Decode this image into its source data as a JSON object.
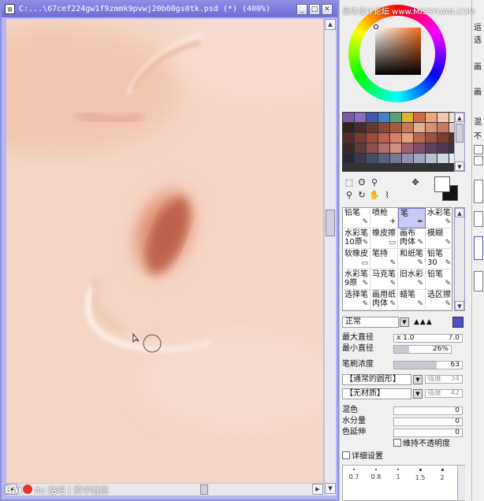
{
  "window": {
    "title": "C:...\\67cef224gw1f9zmmk9pvwj20b60gs0tk.psd (*) (400%)"
  },
  "watermark": {
    "logo": "Bai",
    "paw": "du",
    "text": "贴吧 | 腾宇磨画"
  },
  "branding": {
    "site_text": "思缘设计论坛 www.MISSYUAN.COM"
  },
  "swatch_colors": [
    "#7b58a8",
    "#8b6ac0",
    "#3f5ab0",
    "#4780c8",
    "#5aa078",
    "#e0b030",
    "#d06a48",
    "#e8a878",
    "#f0c8b0",
    "#f4e0d0",
    "#302020",
    "#4a2a2a",
    "#6a3a30",
    "#8a4838",
    "#a85a40",
    "#c87858",
    "#e0b090",
    "#d89070",
    "#c87a60",
    "#e8c8b8",
    "#5a2a28",
    "#7a3a30",
    "#a04a38",
    "#c06048",
    "#d8806a",
    "#e8a080",
    "#b86850",
    "#985040",
    "#784030",
    "#583020",
    "#402828",
    "#603838",
    "#905050",
    "#b07068",
    "#d09080",
    "#a06070",
    "#805068",
    "#604060",
    "#503858",
    "#403048",
    "#282838",
    "#383850",
    "#485068",
    "#586080",
    "#787898",
    "#9090b0",
    "#a0a8c0",
    "#b8c0d0",
    "#d0d8e0",
    "#e8eef4"
  ],
  "tools": {
    "icons": [
      "select-rect-icon",
      "lasso-icon",
      "magic-wand-icon",
      "move-icon",
      "zoom-icon",
      "rotate-icon",
      "hand-icon",
      "eyedropper-icon"
    ]
  },
  "brushes": [
    {
      "label": "铅笔",
      "icon": "✎"
    },
    {
      "label": "喷枪",
      "icon": "✈"
    },
    {
      "label": "笔",
      "icon": "✒"
    },
    {
      "label": "水彩笔",
      "icon": "✎"
    },
    {
      "label": "水彩笔\n10原",
      "icon": "✎"
    },
    {
      "label": "橡皮擦",
      "icon": "▭"
    },
    {
      "label": "画布\n肉体",
      "icon": "✎"
    },
    {
      "label": "模糊",
      "icon": "✎"
    },
    {
      "label": "软橡皮",
      "icon": "▭"
    },
    {
      "label": "笔持",
      "icon": "✎"
    },
    {
      "label": "和纸笔",
      "icon": "✎"
    },
    {
      "label": "铅笔30",
      "icon": "✎"
    },
    {
      "label": "水彩笔\n9原",
      "icon": "✎"
    },
    {
      "label": "马克笔",
      "icon": "✎"
    },
    {
      "label": "旧水彩",
      "icon": "✎"
    },
    {
      "label": "铅笔",
      "icon": "✎"
    },
    {
      "label": "选择笔",
      "icon": "✎"
    },
    {
      "label": "画用纸\n肉体",
      "icon": "✎"
    },
    {
      "label": "蜡笔",
      "icon": "✎"
    },
    {
      "label": "选区擦",
      "icon": "✎"
    }
  ],
  "blend_mode": "正常",
  "size": {
    "label": "最大直径",
    "multiplier": "x 1.0",
    "value": "7.0"
  },
  "min_size": {
    "label": "最小直径",
    "value": "26%",
    "fraction": 0.26
  },
  "density": {
    "label": "笔刷浓度",
    "value": "63",
    "fraction": 0.63
  },
  "shape": {
    "label": "【通常的圆形】",
    "strength_label": "强度",
    "strength": "34"
  },
  "texture": {
    "label": "【无材质】",
    "strength_label": "强度",
    "strength": "42"
  },
  "params": [
    {
      "label": "混色",
      "value": "0"
    },
    {
      "label": "水分量",
      "value": "0"
    },
    {
      "label": "色延伸",
      "value": "0"
    }
  ],
  "keep_opacity": "維持不透明度",
  "detail_settings": "详细设置",
  "dot_sizes": [
    "0.7",
    "0.8",
    "1",
    "1.5",
    "2"
  ],
  "strip": {
    "lines": [
      "运",
      "选",
      "画",
      "画",
      "混",
      "不"
    ]
  }
}
